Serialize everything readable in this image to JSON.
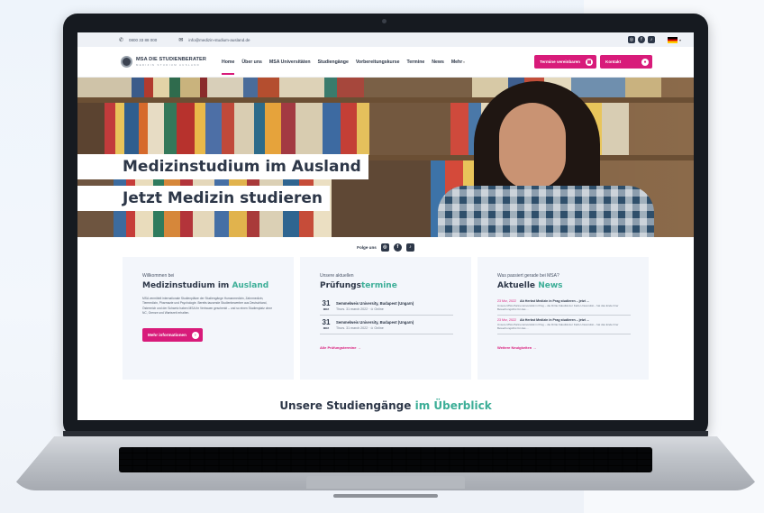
{
  "topbar": {
    "phone_icon": "whatsapp-icon",
    "phone": "0800 33 88 000",
    "email_icon": "mail-icon",
    "email": "info@medizin-studium-ausland.de",
    "social": [
      "instagram-icon",
      "facebook-icon",
      "tiktok-icon"
    ],
    "language": "DE"
  },
  "nav": {
    "logo_main": "MSA DIE STUDIENBERATER",
    "logo_sub": "MEDIZIN STUDIUM AUSLAND",
    "items": [
      {
        "label": "Home",
        "active": true,
        "dropdown": false
      },
      {
        "label": "Über uns",
        "active": false,
        "dropdown": false
      },
      {
        "label": "MSA Universitäten",
        "active": false,
        "dropdown": false
      },
      {
        "label": "Studiengänge",
        "active": false,
        "dropdown": false
      },
      {
        "label": "Vorbereitungskurse",
        "active": false,
        "dropdown": false
      },
      {
        "label": "Termine",
        "active": false,
        "dropdown": false
      },
      {
        "label": "News",
        "active": false,
        "dropdown": false
      },
      {
        "label": "Mehr",
        "active": false,
        "dropdown": true
      }
    ],
    "cta_appointment": "Termine vereinbaren",
    "cta_contact": "Kontakt"
  },
  "hero": {
    "line1": "Medizinstudium im Ausland",
    "line2": "Jetzt Medizin studieren"
  },
  "follow": {
    "label": "Folge uns"
  },
  "card_welcome": {
    "pre": "Willkommen bei",
    "title": "Medizinstudium im",
    "title_accent": "Ausland",
    "text": "MSA vermittelt internationale Studienplätze der Studiengänge Humanmedizin, Zahnmedizin, Tiermedizin, Pharmazie und Psychologie. Bereits tausende Studienbewerber aus Deutschland, Österreich und der Schweiz haben MSA ihr Vertrauen geschenkt – und so einen Studienplatz ohne NC, Grenze und Wartezeit erhalten.",
    "button": "Mehr informationen"
  },
  "card_exams": {
    "pre": "Unsere aktuellen",
    "title": "Prüfungs",
    "title_accent": "termine",
    "items": [
      {
        "day": "31",
        "month": "MRZ",
        "title": "Semmelweis University, Budapest (Ungarn)",
        "sub": "Thurs. 31 march 2022 · ⊙ Online"
      },
      {
        "day": "31",
        "month": "MRZ",
        "title": "Semmelweis University, Budapest (Ungarn)",
        "sub": "Thurs. 31 march 2022 · ⊙ Online"
      }
    ],
    "link": "Alle Prüfungstermine →"
  },
  "card_news": {
    "pre": "Was passiert gerade bei MSA?",
    "title": "Aktuelle",
    "title_accent": "News",
    "items": [
      {
        "date": "23 Mrz, 2022",
        "title": "Ab Herbst Medizin in Prag studieren – jetzt ...",
        "text": "Unsere MSA-Partneruniversität in Prag – die Dritte Fakultät der Karls-Universität – hat das Ende ihrer Bewerbungsfrist für das ..."
      },
      {
        "date": "23 Mrz, 2022",
        "title": "Ab Herbst Medizin in Prag studieren – jetzt ...",
        "text": "Unsere MSA-Partneruniversität in Prag – die Dritte Fakultät der Karls-Universität – hat das Ende ihrer Bewerbungsfrist für das ..."
      }
    ],
    "link": "Weitere Neuigkeiten →"
  },
  "overview": {
    "title": "Unsere Studiengänge",
    "title_accent": "im Überblick"
  },
  "colors": {
    "accent_pink": "#d81b7a",
    "accent_green": "#3cae97",
    "text_dark": "#2d3748",
    "card_bg": "#f3f6fb"
  }
}
